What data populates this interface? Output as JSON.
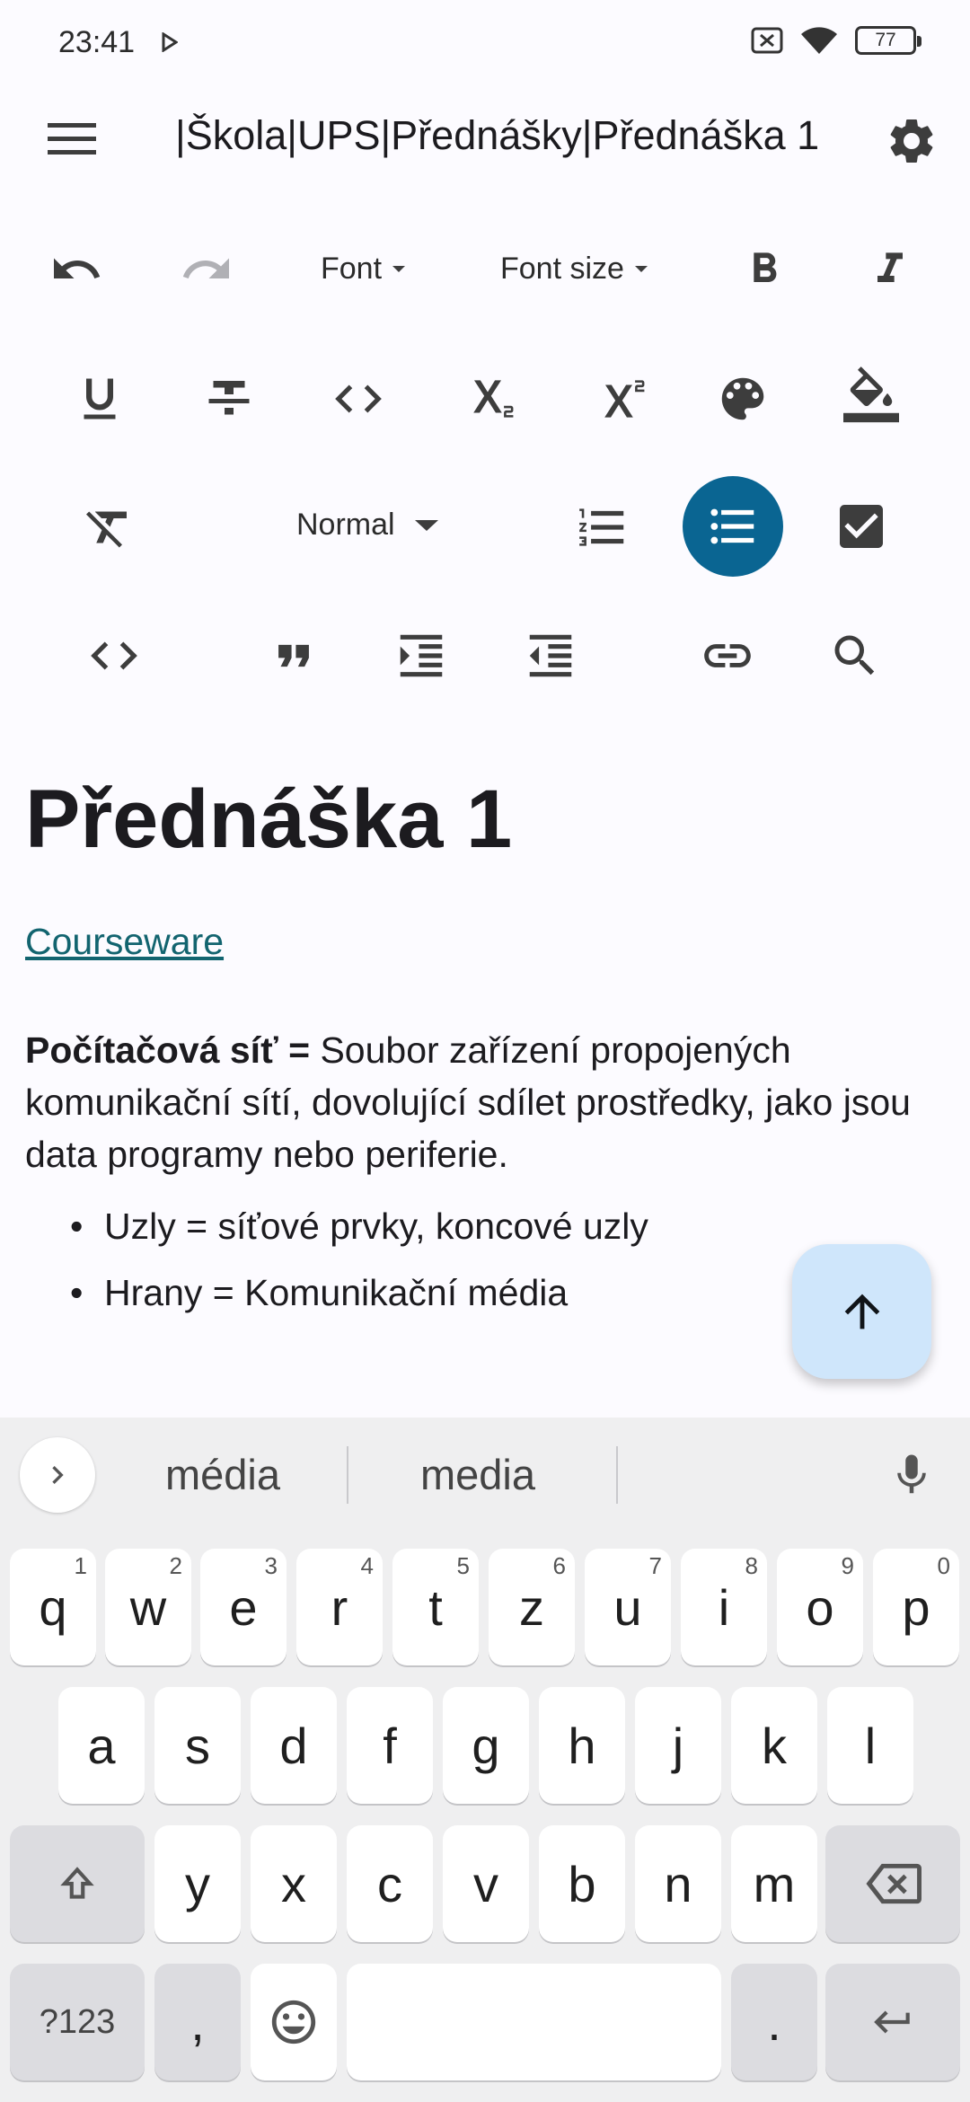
{
  "status_bar": {
    "time": "23:41",
    "battery": "77"
  },
  "top_bar": {
    "title": "|Škola|UPS|Přednášky|Přednáška 1"
  },
  "toolbar": {
    "font_label": "Font",
    "font_size_label": "Font size",
    "style_label": "Normal"
  },
  "content": {
    "heading": "Přednáška 1",
    "link": "Courseware",
    "para_bold": "Počítačová síť =",
    "para_text": " Soubor zařízení propojených komunikační sítí, dovolující sdílet prostředky, jako jsou data programy nebo periferie.",
    "bullets": [
      "Uzly = síťové prvky, koncové uzly",
      "Hrany = Komunikační média"
    ]
  },
  "keyboard": {
    "suggestions": [
      "média",
      "media"
    ],
    "row1": [
      "q",
      "w",
      "e",
      "r",
      "t",
      "z",
      "u",
      "i",
      "o",
      "p"
    ],
    "row1_hints": [
      "1",
      "2",
      "3",
      "4",
      "5",
      "6",
      "7",
      "8",
      "9",
      "0"
    ],
    "row2": [
      "a",
      "s",
      "d",
      "f",
      "g",
      "h",
      "j",
      "k",
      "l"
    ],
    "row3": [
      "y",
      "x",
      "c",
      "v",
      "b",
      "n",
      "m"
    ],
    "symbols_key": "?123",
    "comma_key": ",",
    "period_key": "."
  },
  "colors": {
    "accent": "#0a6592",
    "link": "#12646f",
    "fab": "#cfe6fb"
  }
}
